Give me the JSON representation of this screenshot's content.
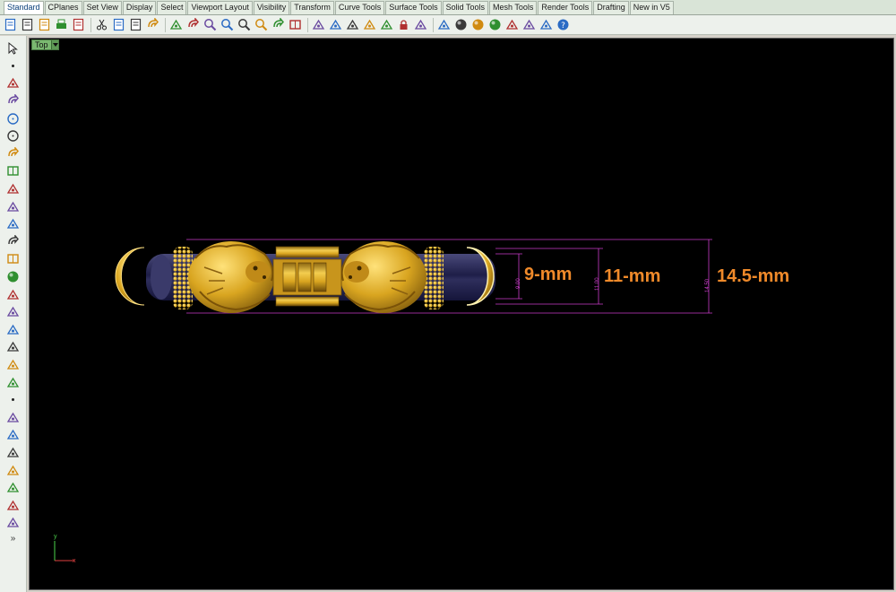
{
  "tabs": [
    "Standard",
    "CPlanes",
    "Set View",
    "Display",
    "Select",
    "Viewport Layout",
    "Visibility",
    "Transform",
    "Curve Tools",
    "Surface Tools",
    "Solid Tools",
    "Mesh Tools",
    "Render Tools",
    "Drafting",
    "New in V5"
  ],
  "active_tab": "Standard",
  "toolbar_icons": [
    "new-file-icon",
    "open-file-icon",
    "save-icon",
    "print-icon",
    "import-icon",
    "cut-icon",
    "copy-icon",
    "paste-icon",
    "undo-icon",
    "pan-icon",
    "rotate-view-icon",
    "zoom-icon",
    "zoom-window-icon",
    "zoom-extents-icon",
    "zoom-selected-icon",
    "undo-view-icon",
    "four-viewports-icon",
    "cplane-icon",
    "snap-icon",
    "grid-icon",
    "layer-icon",
    "light-icon",
    "lock-icon",
    "properties-icon",
    "render-color-icon",
    "shaded-sphere-icon",
    "render-sphere-icon",
    "blue-sphere-icon",
    "light-bulb-icon",
    "settings-icon",
    "history-icon",
    "help-icon"
  ],
  "left_icons": [
    "select-arrow-icon",
    "point-icon",
    "polyline-icon",
    "curve-icon",
    "circle-icon",
    "ellipse-icon",
    "arc-icon",
    "rectangle-icon",
    "polygon-icon",
    "fillet-icon",
    "offset-icon",
    "curve-from-object-icon",
    "box-icon",
    "sphere-icon",
    "cylinder-icon",
    "extrude-icon",
    "surface-icon",
    "transform-icon",
    "boolean-icon",
    "solid-icon",
    "edit-points-icon",
    "trim-icon",
    "split-icon",
    "text-icon",
    "dimension-icon",
    "group-icon",
    "analyze-icon",
    "render-icon"
  ],
  "more_label": "»",
  "viewport": {
    "label": "Top",
    "dimensions": [
      {
        "label": "9-mm",
        "value": "9.00"
      },
      {
        "label": "11-mm",
        "value": "11.00"
      },
      {
        "label": "14.5-mm",
        "value": "14.50"
      }
    ],
    "axis_x": "x",
    "axis_y": "y"
  },
  "colors": {
    "gold": "#d9a520",
    "dimension_line": "#c83cc8",
    "dimension_text": "#f08a2a",
    "tube": "#2a2a5a",
    "viewport_bg": "#000000",
    "viewport_tab": "#7ab870"
  }
}
